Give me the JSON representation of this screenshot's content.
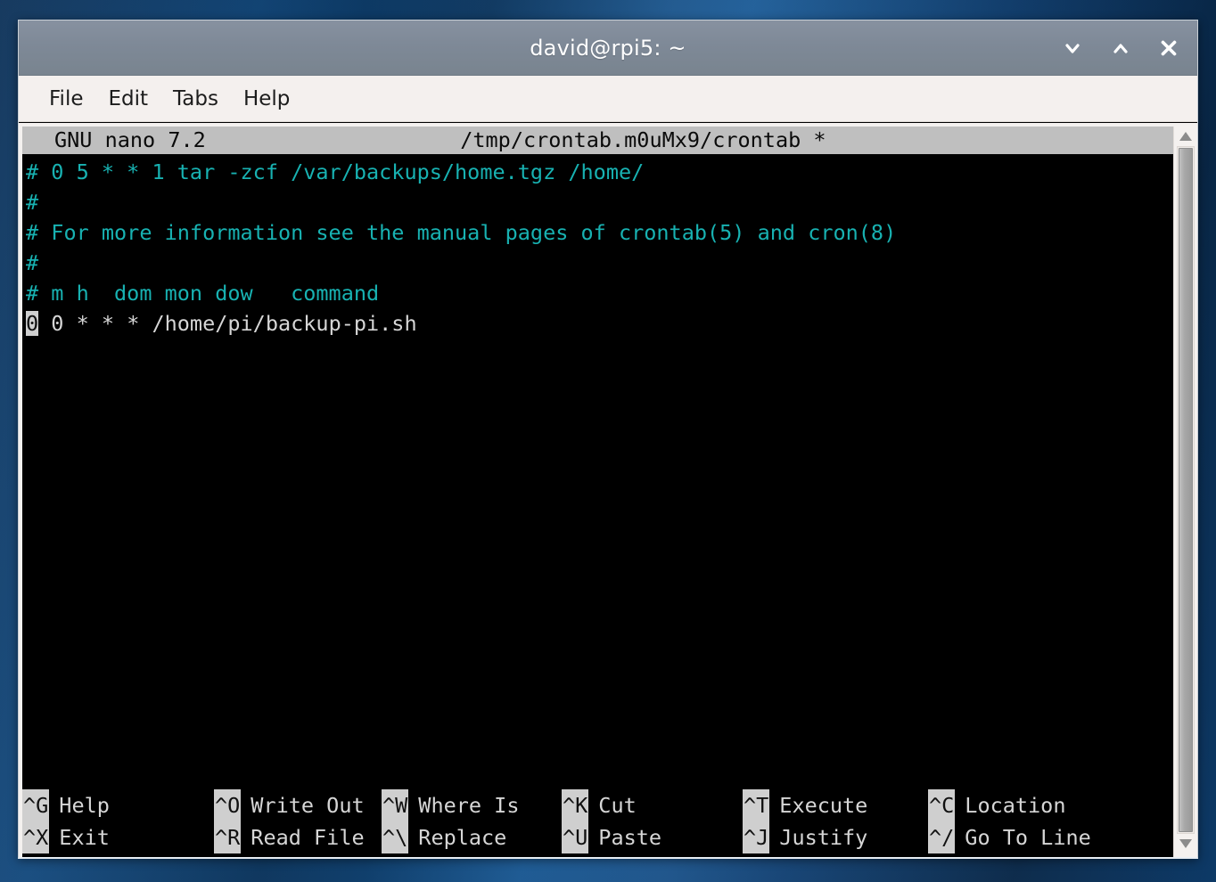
{
  "window": {
    "title": "david@rpi5: ~",
    "controls": [
      {
        "name": "minimize-button",
        "glyph": "chevron-down-icon"
      },
      {
        "name": "maximize-button",
        "glyph": "chevron-up-icon"
      },
      {
        "name": "close-button",
        "glyph": "close-icon"
      }
    ]
  },
  "menubar": {
    "items": [
      {
        "label": "File"
      },
      {
        "label": "Edit"
      },
      {
        "label": "Tabs"
      },
      {
        "label": "Help"
      }
    ]
  },
  "nano": {
    "version_label": "GNU nano 7.2",
    "filename": "/tmp/crontab.m0uMx9/crontab *",
    "lines": [
      {
        "text": "# 0 5 * * 1 tar -zcf /var/backups/home.tgz /home/",
        "style": "comment"
      },
      {
        "text": "#",
        "style": "comment"
      },
      {
        "text": "# For more information see the manual pages of crontab(5) and cron(8)",
        "style": "comment"
      },
      {
        "text": "#",
        "style": "comment"
      },
      {
        "text": "# m h  dom mon dow   command",
        "style": "comment"
      },
      {
        "text": "0 0 * * * /home/pi/backup-pi.sh",
        "style": "plain",
        "cursor_index": 0
      }
    ],
    "cursor_char": "0",
    "line_after_cursor": " 0 * * * /home/pi/backup-pi.sh",
    "shortcuts_row1": [
      {
        "key": "^G",
        "label": "Help"
      },
      {
        "key": "^O",
        "label": "Write Out"
      },
      {
        "key": "^W",
        "label": "Where Is"
      },
      {
        "key": "^K",
        "label": "Cut"
      },
      {
        "key": "^T",
        "label": "Execute"
      },
      {
        "key": "^C",
        "label": "Location"
      }
    ],
    "shortcuts_row2": [
      {
        "key": "^X",
        "label": "Exit"
      },
      {
        "key": "^R",
        "label": "Read File"
      },
      {
        "key": "^\\",
        "label": "Replace"
      },
      {
        "key": "^U",
        "label": "Paste"
      },
      {
        "key": "^J",
        "label": "Justify"
      },
      {
        "key": "^/",
        "label": "Go To Line"
      }
    ]
  },
  "scrollbar": {
    "up_arrow": "triangle-up-icon",
    "down_arrow": "triangle-down-icon",
    "thumb_top_percent": 0,
    "thumb_height_percent": 100
  },
  "colors": {
    "titlebar": "#7e8997",
    "menubar": "#f4f0ee",
    "terminal_bg": "#000000",
    "comment_text": "#18b2b2",
    "plain_text": "#d6d6d6",
    "nano_bar_bg": "#bfbfbf",
    "desktop": "#0d3a66"
  }
}
